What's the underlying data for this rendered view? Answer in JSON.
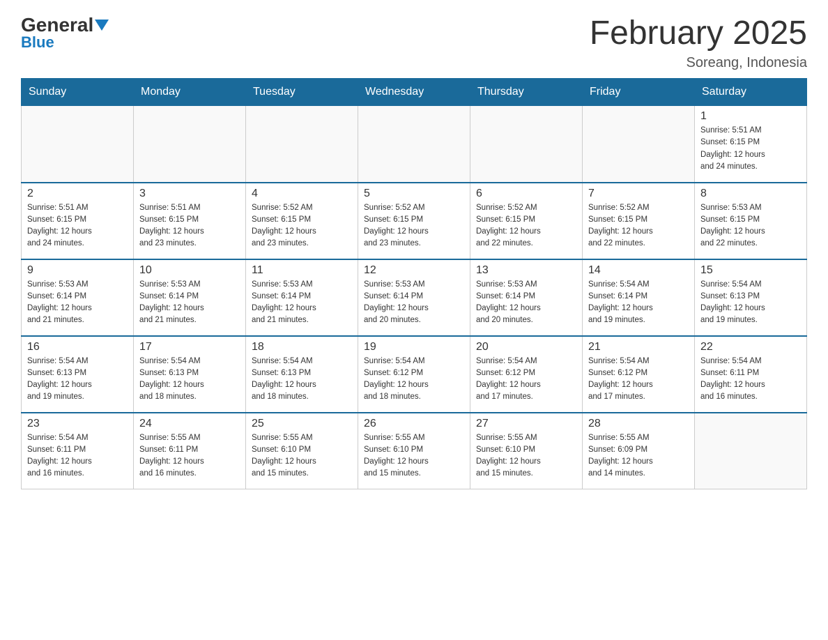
{
  "logo": {
    "general": "General",
    "blue": "Blue"
  },
  "header": {
    "title": "February 2025",
    "location": "Soreang, Indonesia"
  },
  "days_of_week": [
    "Sunday",
    "Monday",
    "Tuesday",
    "Wednesday",
    "Thursday",
    "Friday",
    "Saturday"
  ],
  "weeks": [
    [
      {
        "day": "",
        "info": ""
      },
      {
        "day": "",
        "info": ""
      },
      {
        "day": "",
        "info": ""
      },
      {
        "day": "",
        "info": ""
      },
      {
        "day": "",
        "info": ""
      },
      {
        "day": "",
        "info": ""
      },
      {
        "day": "1",
        "info": "Sunrise: 5:51 AM\nSunset: 6:15 PM\nDaylight: 12 hours\nand 24 minutes."
      }
    ],
    [
      {
        "day": "2",
        "info": "Sunrise: 5:51 AM\nSunset: 6:15 PM\nDaylight: 12 hours\nand 24 minutes."
      },
      {
        "day": "3",
        "info": "Sunrise: 5:51 AM\nSunset: 6:15 PM\nDaylight: 12 hours\nand 23 minutes."
      },
      {
        "day": "4",
        "info": "Sunrise: 5:52 AM\nSunset: 6:15 PM\nDaylight: 12 hours\nand 23 minutes."
      },
      {
        "day": "5",
        "info": "Sunrise: 5:52 AM\nSunset: 6:15 PM\nDaylight: 12 hours\nand 23 minutes."
      },
      {
        "day": "6",
        "info": "Sunrise: 5:52 AM\nSunset: 6:15 PM\nDaylight: 12 hours\nand 22 minutes."
      },
      {
        "day": "7",
        "info": "Sunrise: 5:52 AM\nSunset: 6:15 PM\nDaylight: 12 hours\nand 22 minutes."
      },
      {
        "day": "8",
        "info": "Sunrise: 5:53 AM\nSunset: 6:15 PM\nDaylight: 12 hours\nand 22 minutes."
      }
    ],
    [
      {
        "day": "9",
        "info": "Sunrise: 5:53 AM\nSunset: 6:14 PM\nDaylight: 12 hours\nand 21 minutes."
      },
      {
        "day": "10",
        "info": "Sunrise: 5:53 AM\nSunset: 6:14 PM\nDaylight: 12 hours\nand 21 minutes."
      },
      {
        "day": "11",
        "info": "Sunrise: 5:53 AM\nSunset: 6:14 PM\nDaylight: 12 hours\nand 21 minutes."
      },
      {
        "day": "12",
        "info": "Sunrise: 5:53 AM\nSunset: 6:14 PM\nDaylight: 12 hours\nand 20 minutes."
      },
      {
        "day": "13",
        "info": "Sunrise: 5:53 AM\nSunset: 6:14 PM\nDaylight: 12 hours\nand 20 minutes."
      },
      {
        "day": "14",
        "info": "Sunrise: 5:54 AM\nSunset: 6:14 PM\nDaylight: 12 hours\nand 19 minutes."
      },
      {
        "day": "15",
        "info": "Sunrise: 5:54 AM\nSunset: 6:13 PM\nDaylight: 12 hours\nand 19 minutes."
      }
    ],
    [
      {
        "day": "16",
        "info": "Sunrise: 5:54 AM\nSunset: 6:13 PM\nDaylight: 12 hours\nand 19 minutes."
      },
      {
        "day": "17",
        "info": "Sunrise: 5:54 AM\nSunset: 6:13 PM\nDaylight: 12 hours\nand 18 minutes."
      },
      {
        "day": "18",
        "info": "Sunrise: 5:54 AM\nSunset: 6:13 PM\nDaylight: 12 hours\nand 18 minutes."
      },
      {
        "day": "19",
        "info": "Sunrise: 5:54 AM\nSunset: 6:12 PM\nDaylight: 12 hours\nand 18 minutes."
      },
      {
        "day": "20",
        "info": "Sunrise: 5:54 AM\nSunset: 6:12 PM\nDaylight: 12 hours\nand 17 minutes."
      },
      {
        "day": "21",
        "info": "Sunrise: 5:54 AM\nSunset: 6:12 PM\nDaylight: 12 hours\nand 17 minutes."
      },
      {
        "day": "22",
        "info": "Sunrise: 5:54 AM\nSunset: 6:11 PM\nDaylight: 12 hours\nand 16 minutes."
      }
    ],
    [
      {
        "day": "23",
        "info": "Sunrise: 5:54 AM\nSunset: 6:11 PM\nDaylight: 12 hours\nand 16 minutes."
      },
      {
        "day": "24",
        "info": "Sunrise: 5:55 AM\nSunset: 6:11 PM\nDaylight: 12 hours\nand 16 minutes."
      },
      {
        "day": "25",
        "info": "Sunrise: 5:55 AM\nSunset: 6:10 PM\nDaylight: 12 hours\nand 15 minutes."
      },
      {
        "day": "26",
        "info": "Sunrise: 5:55 AM\nSunset: 6:10 PM\nDaylight: 12 hours\nand 15 minutes."
      },
      {
        "day": "27",
        "info": "Sunrise: 5:55 AM\nSunset: 6:10 PM\nDaylight: 12 hours\nand 15 minutes."
      },
      {
        "day": "28",
        "info": "Sunrise: 5:55 AM\nSunset: 6:09 PM\nDaylight: 12 hours\nand 14 minutes."
      },
      {
        "day": "",
        "info": ""
      }
    ]
  ]
}
